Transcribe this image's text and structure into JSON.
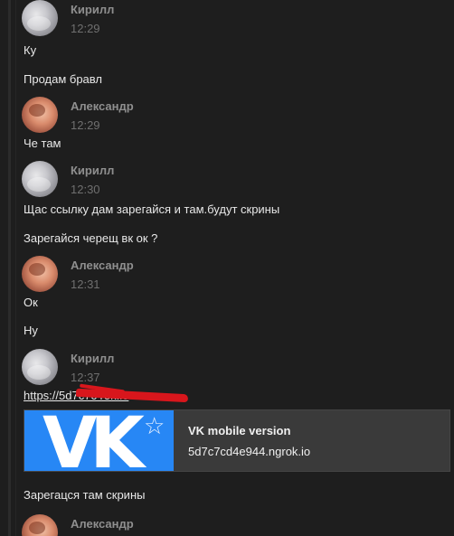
{
  "messages": [
    {
      "author": "Кирилл",
      "time": "12:29",
      "lines": [
        "Ку",
        "Продам бравл"
      ]
    },
    {
      "author": "Александр",
      "time": "12:29",
      "lines": [
        "Че там"
      ]
    },
    {
      "author": "Кирилл",
      "time": "12:30",
      "lines": [
        "Щас ссылку дам зарегайся и там.будут скрины",
        "Зарегайся черещ вк ок ?"
      ]
    },
    {
      "author": "Александр",
      "time": "12:31",
      "lines": [
        "Ок",
        "Ну"
      ]
    },
    {
      "author": "Кирилл",
      "time": "12:37",
      "link": "https://5d7c7c                 rok.io",
      "preview": {
        "title": "VK mobile version",
        "domain": "5d7c7cd4e944.ngrok.io"
      },
      "lines": [
        "Зарегацся там скрины"
      ]
    },
    {
      "author": "Александр"
    }
  ],
  "icons": {
    "avatar_kirill": "avatar",
    "avatar_alexandr": "avatar",
    "preview_logo": "vk-logo-icon",
    "preview_star": "star-icon"
  },
  "colors": {
    "background": "#1e1e1e",
    "author": "#8f8f8f",
    "timestamp": "#6f6f6f",
    "text": "#e8e8e8",
    "vk_blue": "#2787f5",
    "redaction": "#d8161c"
  }
}
